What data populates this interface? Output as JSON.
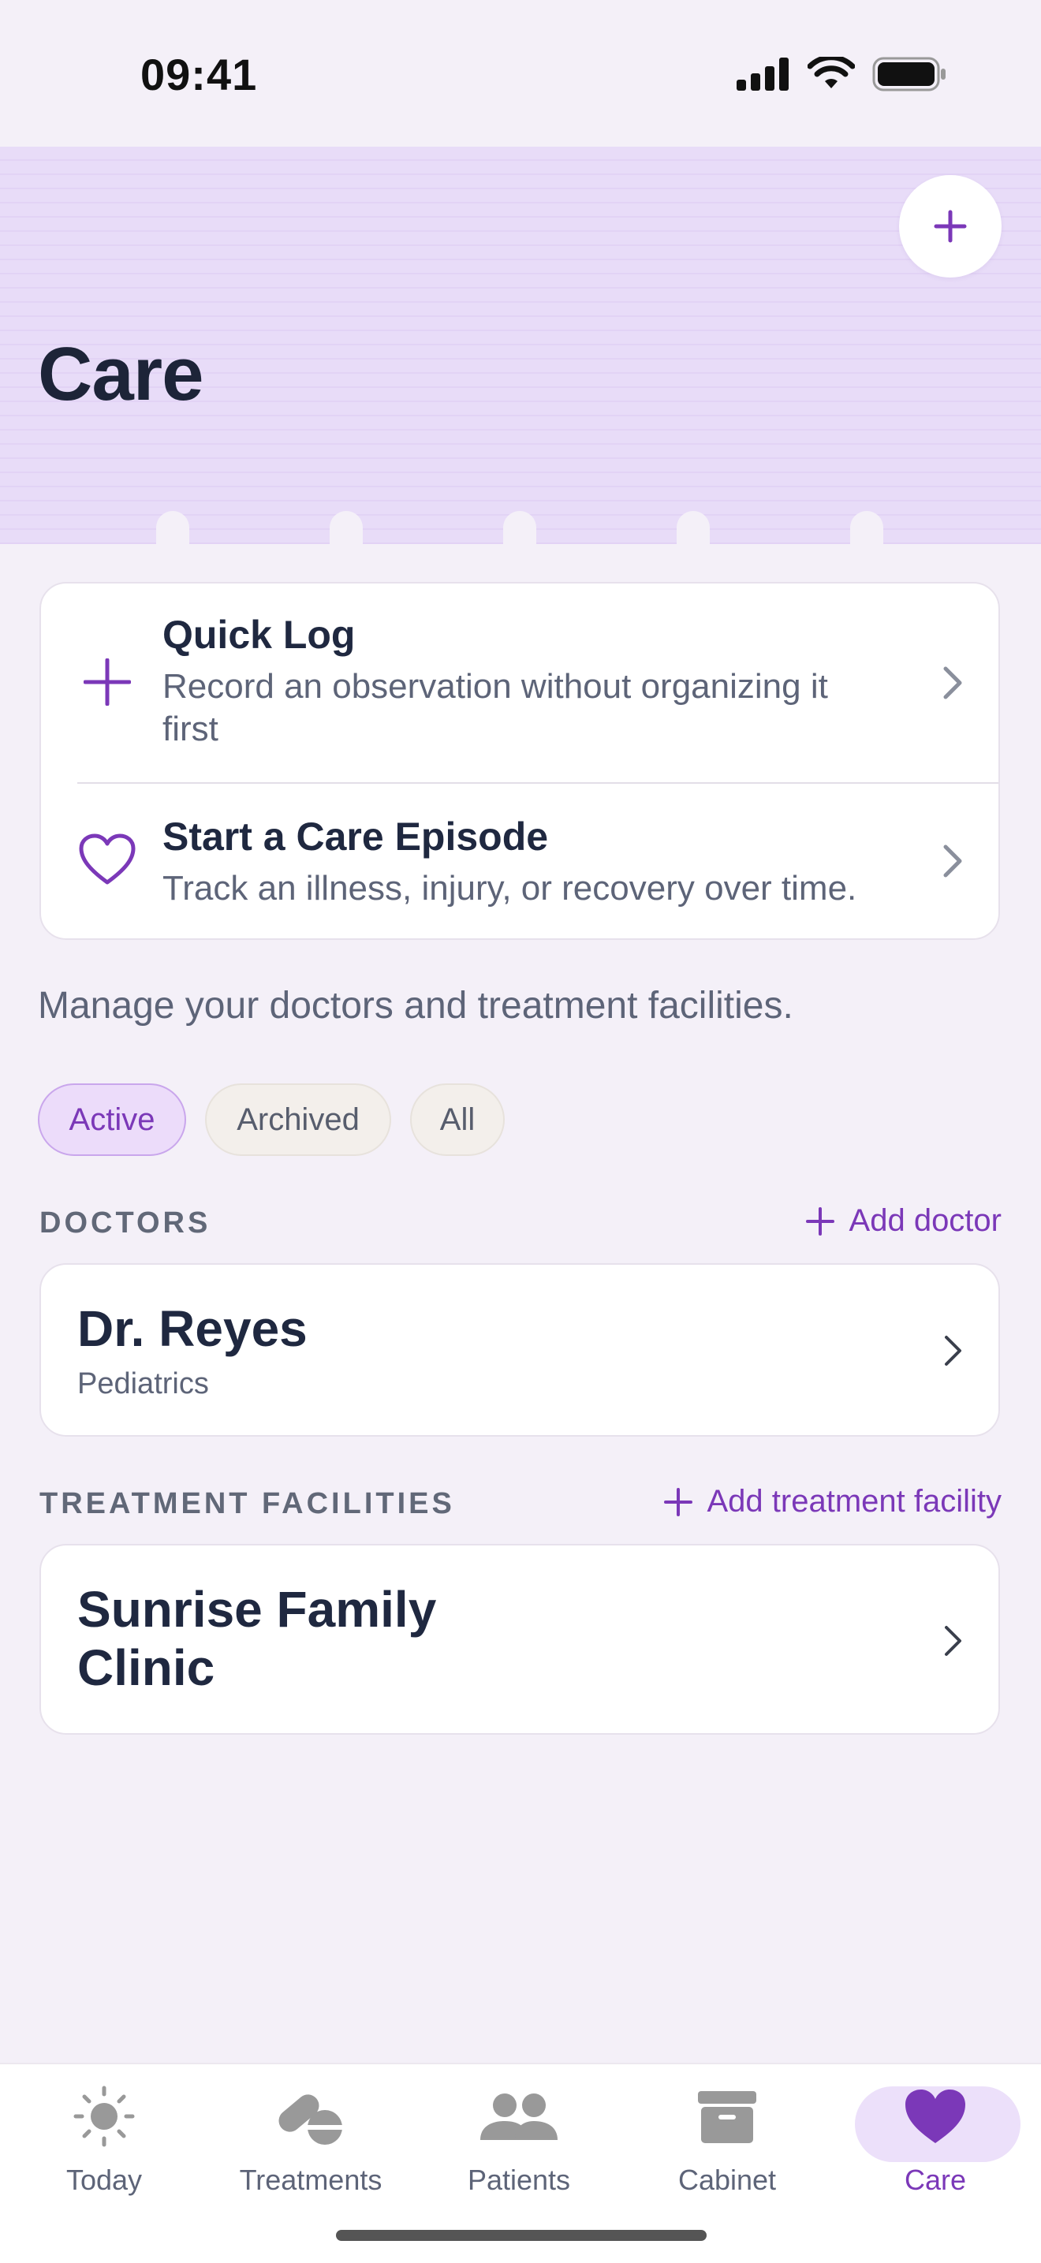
{
  "status_bar": {
    "time": "09:41"
  },
  "header": {
    "title": "Care"
  },
  "actions": [
    {
      "title": "Quick Log",
      "subtitle": "Record an observation without organizing it first"
    },
    {
      "title": "Start a Care Episode",
      "subtitle": "Track an illness, injury, or recovery over time."
    }
  ],
  "intro": "Manage your doctors and treatment facilities.",
  "filters": {
    "active": "Active",
    "archived": "Archived",
    "all": "All",
    "selected": "Active"
  },
  "doctors": {
    "label": "DOCTORS",
    "add_label": "Add doctor",
    "items": [
      {
        "name": "Dr. Reyes",
        "specialty": "Pediatrics"
      }
    ]
  },
  "facilities": {
    "label": "TREATMENT FACILITIES",
    "add_label": "Add treatment facility",
    "items": [
      {
        "name": "Sunrise Family Clinic"
      }
    ]
  },
  "tabbar": {
    "today": "Today",
    "treatments": "Treatments",
    "patients": "Patients",
    "cabinet": "Cabinet",
    "care": "Care",
    "selected": "Care"
  },
  "colors": {
    "accent": "#7b38b8",
    "header_bg": "#e8dcf8",
    "page_bg": "#f4f0f8"
  }
}
